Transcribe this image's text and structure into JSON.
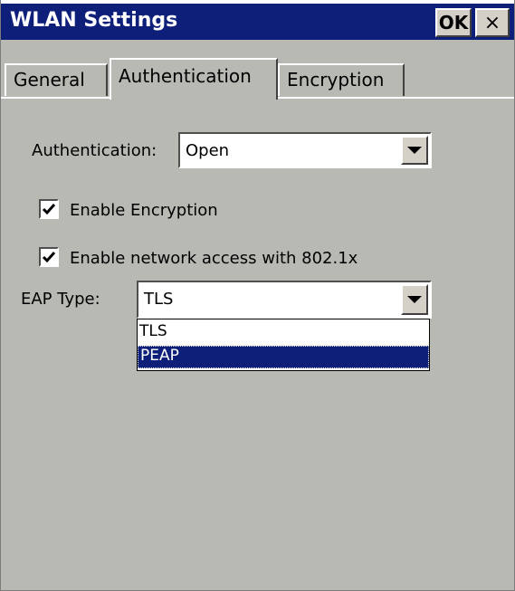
{
  "window": {
    "title": "WLAN Settings",
    "ok_label": "OK",
    "close_label": "×"
  },
  "tabs": [
    {
      "label": "General"
    },
    {
      "label": "Authentication",
      "selected": true
    },
    {
      "label": "Encryption"
    }
  ],
  "authentication": {
    "label": "Authentication:",
    "value": "Open"
  },
  "enable_encryption": {
    "label": "Enable Encryption",
    "checked": true
  },
  "enable_8021x": {
    "label": "Enable network access with 802.1x",
    "checked": true
  },
  "eap_type": {
    "label": "EAP Type:",
    "value": "TLS",
    "options": [
      "TLS",
      "PEAP"
    ],
    "highlighted": "PEAP"
  },
  "colors": {
    "titlebar": "#0e1f7a",
    "dialog_bg": "#b9b9b4",
    "highlight": "#0e1f7a"
  }
}
